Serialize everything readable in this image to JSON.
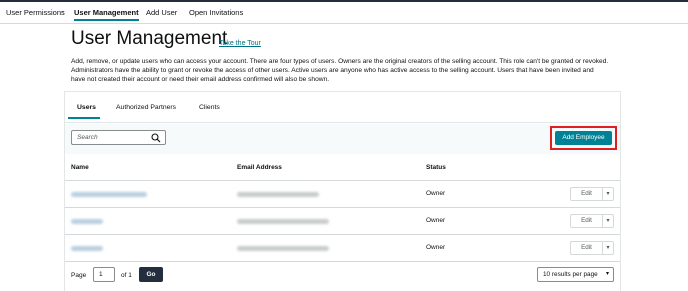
{
  "breadcrumb": {
    "items": [
      {
        "label": "User Permissions"
      },
      {
        "label": "User Management"
      },
      {
        "label": "Add User"
      },
      {
        "label": "Open Invitations"
      }
    ],
    "separator": "→"
  },
  "header": {
    "title": "User Management",
    "tour_link": "Take the Tour",
    "description": "Add, remove, or update users who can access your account. There are four types of users. Owners are the original creators of the selling account. This role can't be granted or revoked. Administrators have the ability to grant or revoke the access of other users. Active users are anyone who has active access to the selling account. Users that have been invited and have not created their account or need their email address confirmed will also be shown."
  },
  "tabs": [
    {
      "label": "Users",
      "active": true
    },
    {
      "label": "Authorized Partners",
      "active": false
    },
    {
      "label": "Clients",
      "active": false
    }
  ],
  "search": {
    "placeholder": "Search",
    "icon": "search-icon"
  },
  "add_employee_label": "Add Employee",
  "table": {
    "columns": [
      "Name",
      "Email Address",
      "Status"
    ],
    "rows": [
      {
        "status": "Owner",
        "edit_label": "Edit"
      },
      {
        "status": "Owner",
        "edit_label": "Edit"
      },
      {
        "status": "Owner",
        "edit_label": "Edit"
      }
    ]
  },
  "pagination": {
    "page_label": "Page",
    "current_page": "1",
    "of_label": "of 1",
    "go_label": "Go",
    "per_page_label": "10 results per page"
  },
  "colors": {
    "accent": "#008296",
    "highlight_outline": "#e02020",
    "dark": "#232f3e"
  }
}
